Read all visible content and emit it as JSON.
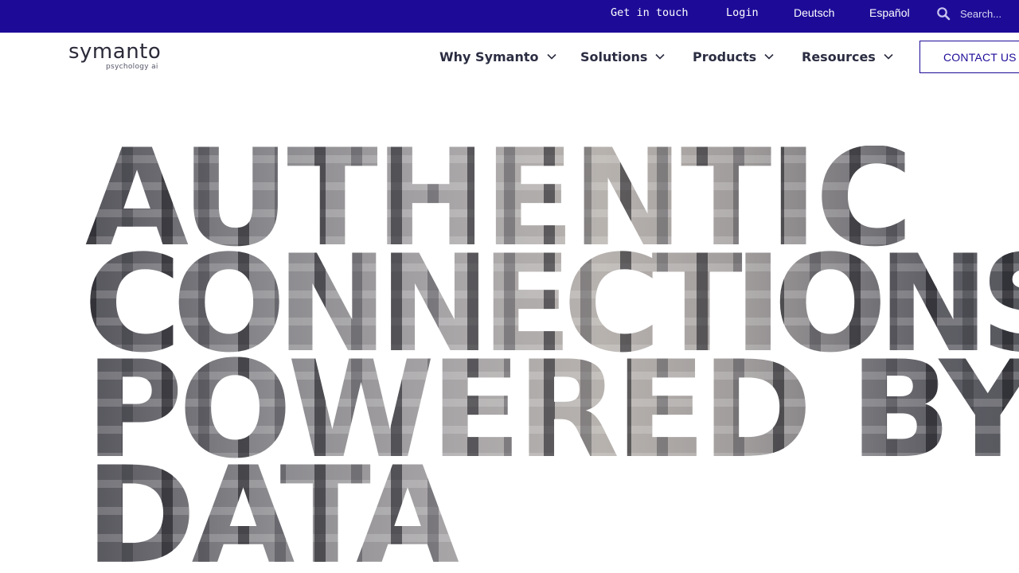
{
  "topbar": {
    "get_in_touch": "Get in touch",
    "login": "Login",
    "lang_de": "Deutsch",
    "lang_es": "Español",
    "search_placeholder": "Search..."
  },
  "logo": {
    "wordmark": "symanto",
    "tagline": "psychology ai"
  },
  "nav": {
    "items": [
      {
        "label": "Why Symanto"
      },
      {
        "label": "Solutions"
      },
      {
        "label": "Products"
      },
      {
        "label": "Resources"
      }
    ],
    "contact_label": "CONTACT US"
  },
  "hero": {
    "lines": [
      "AUTHENTIC",
      "CONNECTIONS",
      "POWERED BY",
      "DATA"
    ]
  },
  "colors": {
    "brand_primary": "#1d0b98",
    "nav_text": "#2b2d42",
    "white": "#ffffff"
  },
  "icons": {
    "search": "search-icon",
    "chevron": "chevron-down-icon"
  }
}
